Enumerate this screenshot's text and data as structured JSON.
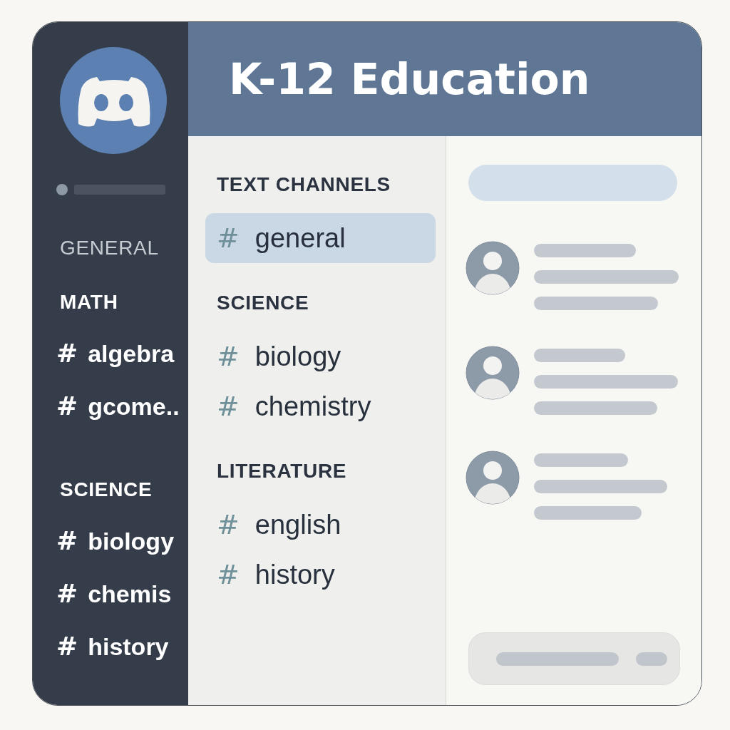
{
  "header": {
    "title": "K-12 Education"
  },
  "server_sidebar": {
    "sections": [
      {
        "title": "GENERAL",
        "muted": true
      },
      {
        "title": "MATH",
        "muted": false,
        "channels": [
          {
            "prefix": "#",
            "name": "algebra",
            "selected": false
          },
          {
            "prefix": "#",
            "name": "gcome..",
            "selected": false
          }
        ]
      },
      {
        "title": "SCIENCE",
        "muted": false,
        "channels": [
          {
            "prefix": "#",
            "name": "biology",
            "selected": false
          },
          {
            "prefix": "#",
            "name": "chemis",
            "selected": false
          },
          {
            "prefix": "#",
            "name": "history",
            "selected": false
          }
        ]
      }
    ]
  },
  "channel_list": {
    "sections": [
      {
        "title": "TEXT CHANNELS",
        "channels": [
          {
            "prefix": "#",
            "name": "general",
            "selected": true
          }
        ]
      },
      {
        "title": "SCIENCE",
        "channels": [
          {
            "prefix": "#",
            "name": "biology",
            "selected": false
          },
          {
            "prefix": "#",
            "name": "chemistry",
            "selected": false
          }
        ]
      },
      {
        "title": "LITERATURE",
        "channels": [
          {
            "prefix": "#",
            "name": "english",
            "selected": false
          },
          {
            "prefix": "#",
            "name": "history",
            "selected": false
          }
        ]
      }
    ]
  }
}
